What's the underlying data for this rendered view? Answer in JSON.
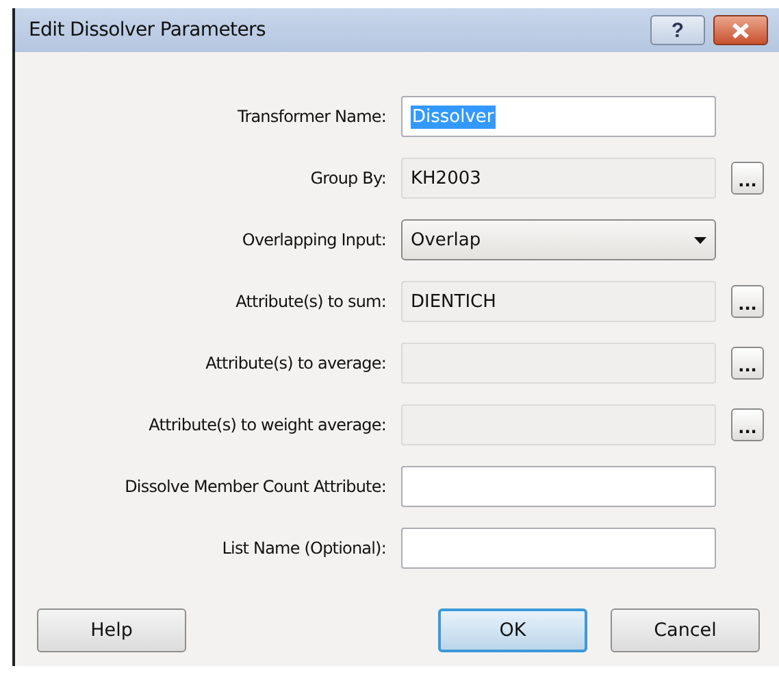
{
  "window": {
    "title": "Edit Dissolver Parameters",
    "help_glyph": "?"
  },
  "fields": [
    {
      "kind": "text",
      "label": "Transformer Name:",
      "value": "Dissolver",
      "selected": true
    },
    {
      "kind": "picker",
      "label": "Group By:",
      "value": "KH2003",
      "button": "..."
    },
    {
      "kind": "dropdown",
      "label": "Overlapping Input:",
      "value": "Overlap"
    },
    {
      "kind": "picker",
      "label": "Attribute(s) to sum:",
      "value": "DIENTICH",
      "button": "..."
    },
    {
      "kind": "picker",
      "label": "Attribute(s) to average:",
      "button": "..."
    },
    {
      "kind": "picker",
      "label": "Attribute(s) to weight average:",
      "button": "..."
    },
    {
      "kind": "text",
      "label": "Dissolve Member Count Attribute:"
    },
    {
      "kind": "text",
      "label": "List Name (Optional):"
    }
  ],
  "buttons": [
    {
      "label": "Help",
      "default": false
    },
    {
      "label": "OK",
      "default": true
    },
    {
      "label": "Cancel",
      "default": false
    }
  ]
}
